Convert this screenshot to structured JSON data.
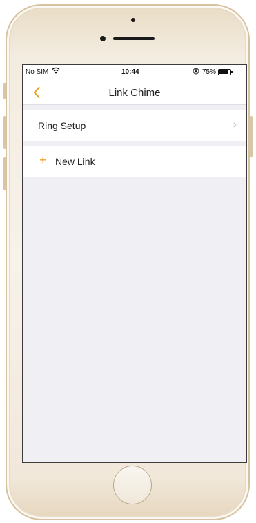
{
  "status_bar": {
    "carrier": "No SIM",
    "wifi_icon": "wifi-icon",
    "time": "10:44",
    "lock_icon": "orientation-lock-icon",
    "battery_percent": "75%",
    "battery_level": 0.75
  },
  "nav": {
    "back_icon": "‹",
    "title": "Link Chime"
  },
  "rows": {
    "ring_setup": {
      "label": "Ring Setup",
      "chevron": "›"
    },
    "new_link": {
      "plus": "+",
      "label": "New Link"
    }
  },
  "colors": {
    "accent": "#f0a020",
    "background": "#efeff4",
    "phone_frame": "#e9dcc5"
  }
}
